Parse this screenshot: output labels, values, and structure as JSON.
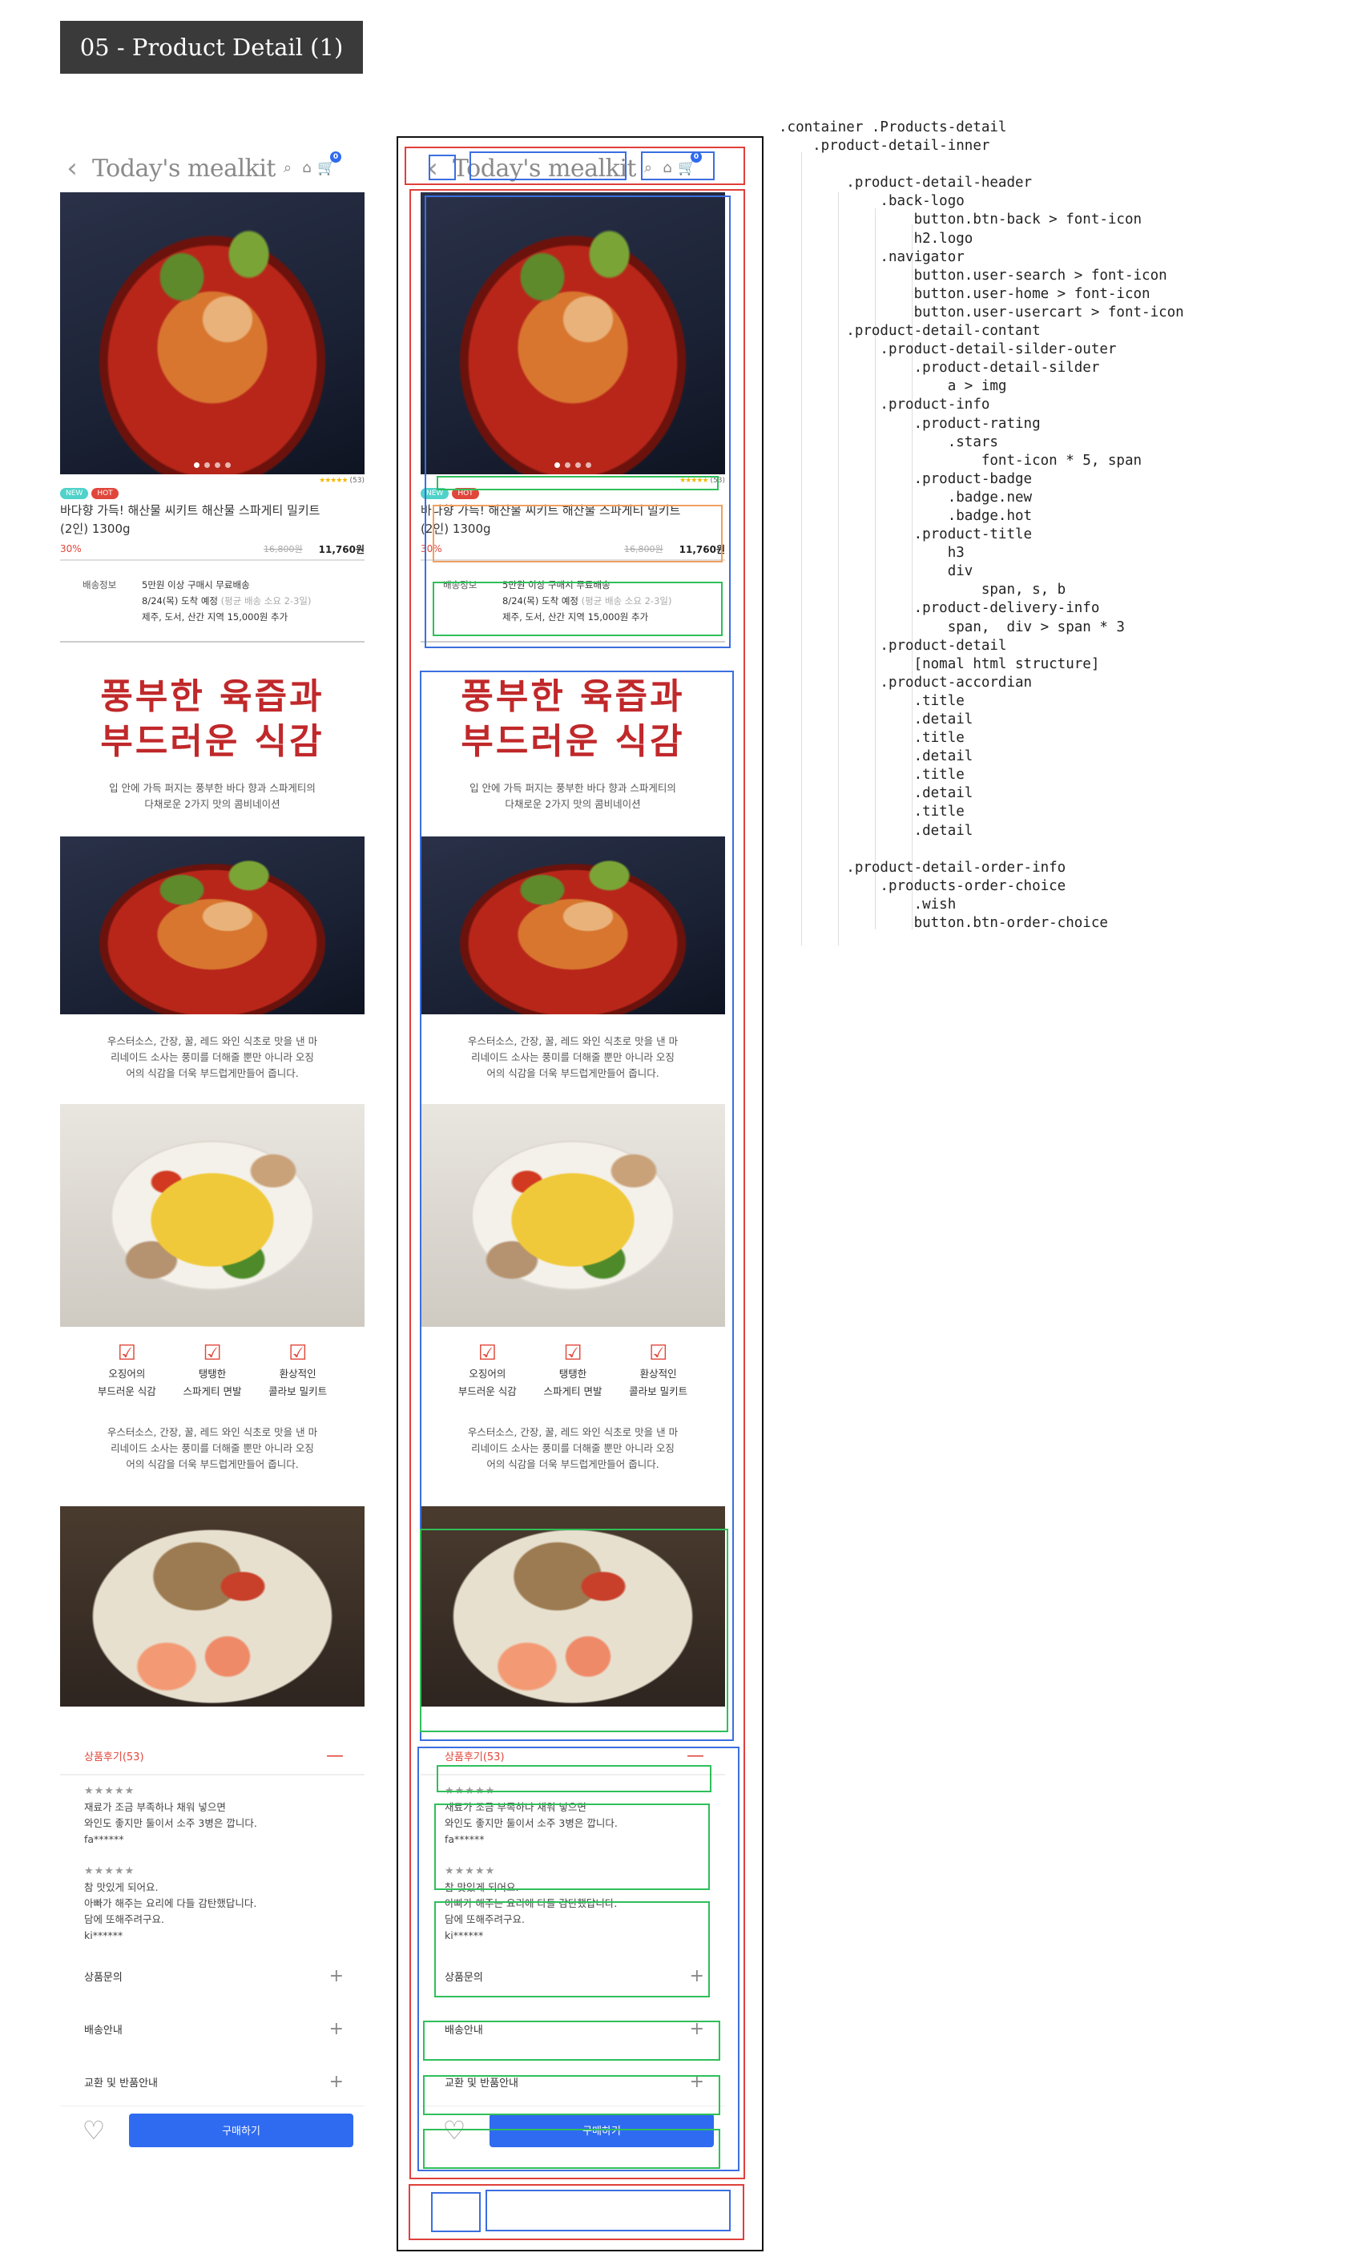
{
  "section_title": "05 - Product Detail (1)",
  "header": {
    "back_icon": "‹",
    "logo": "Today's mealkit",
    "cart_count": "0"
  },
  "rating": {
    "stars": "★★★★★",
    "count": "(53)"
  },
  "badges": {
    "new": "NEW",
    "hot": "HOT"
  },
  "product": {
    "title_line1": "바다향 가득! 해산물 씨키트 해산물 스파게티 밀키트",
    "title_line2": "(2인) 1300g",
    "discount": "30%",
    "original_price": "16,800원",
    "sale_price": "11,760원"
  },
  "delivery": {
    "label": "배송정보",
    "line1": "5만원 이상 구매시 무료배송",
    "line2_main": "8/24(목) 도착 예정 ",
    "line2_note": "(평균 배송 소요 2-3일)",
    "line3": "제주, 도서, 산간 지역 15,000원 추가"
  },
  "detail": {
    "hero_line1": "풍부한 육즙과",
    "hero_line2": "부드러운 식감",
    "sub_line1": "입 안에 가득 퍼지는 풍부한 바다 향과 스파게티의",
    "sub_line2": "다채로운 2가지 맛의 콤비네이션",
    "para_line1": "우스터소스, 간장, 꿀, 레드 와인 식초로 맛을 낸 마",
    "para_line2": "리네이드 소사는 풍미를 더해줄 뿐만 아니라 오징",
    "para_line3": "어의 식감을 더욱 부드럽게만들어 줍니다.",
    "features": [
      {
        "line1": "오징어의",
        "line2": "부드러운 식감"
      },
      {
        "line1": "탱탱한",
        "line2": "스파게티 면발"
      },
      {
        "line1": "환상적인",
        "line2": "콜라보 밀키트"
      }
    ]
  },
  "accordion": {
    "reviews_title": "상품후기(53)",
    "reviews": [
      {
        "stars": "★★★★★",
        "line1": "재료가 조금 부족하나 채워 넣으면",
        "line2": "와인도 좋지만 둘이서 소주 3병은 깝니다.",
        "line3": "",
        "author": "fa******"
      },
      {
        "stars": "★★★★★",
        "line1": "참 맛있게 되어요.",
        "line2": "아빠가 해주는 요리에 다들 감탄했답니다.",
        "line3": "담에 또해주려구요.",
        "author": "ki******"
      }
    ],
    "items": [
      "상품문의",
      "배송안내",
      "교환 및 반품안내"
    ],
    "minus": "—",
    "plus": "+"
  },
  "order": {
    "wish_icon": "♡",
    "buy_label": "구매하기"
  },
  "code_lines": [
    ".container .Products-detail",
    "    .product-detail-inner",
    "",
    "        .product-detail-header",
    "            .back-logo",
    "                button.btn-back > font-icon",
    "                h2.logo",
    "            .navigator",
    "                button.user-search > font-icon",
    "                button.user-home > font-icon",
    "                button.user-usercart > font-icon",
    "        .product-detail-contant",
    "            .product-detail-silder-outer",
    "                .product-detail-silder",
    "                    a > img",
    "            .product-info",
    "                .product-rating",
    "                    .stars",
    "                        font-icon * 5, span",
    "                .product-badge",
    "                    .badge.new",
    "                    .badge.hot",
    "                .product-title",
    "                    h3",
    "                    div",
    "                        span, s, b",
    "                .product-delivery-info",
    "                    span,  div > span * 3",
    "            .product-detail",
    "                [nomal html structure]",
    "            .product-accordian",
    "                .title",
    "                .detail",
    "                .title",
    "                .detail",
    "                .title",
    "                .detail",
    "                .title",
    "                .detail",
    "",
    "        .product-detail-order-info",
    "            .products-order-choice",
    "                .wish",
    "                button.btn-order-choice"
  ],
  "colors": {
    "accent_red": "#e0463a",
    "buy_blue": "#2f6bf0",
    "tab_bg": "#3a3a3a"
  }
}
